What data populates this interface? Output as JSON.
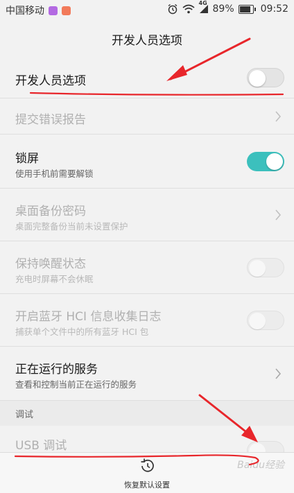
{
  "status_bar": {
    "carrier": "中国移动",
    "network_label": "4G",
    "battery": "89%",
    "time": "09:52",
    "icons": [
      "app-purple-icon",
      "app-orange-icon",
      "alarm-icon",
      "wifi-icon",
      "signal-icon",
      "battery-icon"
    ]
  },
  "header": {
    "title": "开发人员选项"
  },
  "settings": [
    {
      "label": "开发人员选项",
      "state": "off",
      "enabled": true
    },
    {
      "label": "提交错误报告",
      "enabled": false
    },
    {
      "label": "锁屏",
      "sub": "使用手机前需要解锁",
      "state": "on",
      "enabled": true
    },
    {
      "label": "桌面备份密码",
      "sub": "桌面完整备份当前未设置保护",
      "enabled": false
    },
    {
      "label": "保持唤醒状态",
      "sub": "充电时屏幕不会休眠",
      "state": "off",
      "enabled": false
    },
    {
      "label": "开启蓝牙 HCI 信息收集日志",
      "sub": "捕获单个文件中的所有蓝牙 HCI 包",
      "state": "off",
      "enabled": false
    },
    {
      "label": "正在运行的服务",
      "sub": "查看和控制当前正在运行的服务",
      "enabled": true
    }
  ],
  "debug_section": {
    "title": "调试",
    "usb_label": "USB 调试",
    "usb_state": "off"
  },
  "bottom": {
    "restore_label": "恢复默认设置"
  },
  "watermark": "Baidu经验",
  "colors": {
    "accent_toggle": "#3cc0bd",
    "annotation_red": "#e8262b",
    "background": "#f2f2f2"
  }
}
